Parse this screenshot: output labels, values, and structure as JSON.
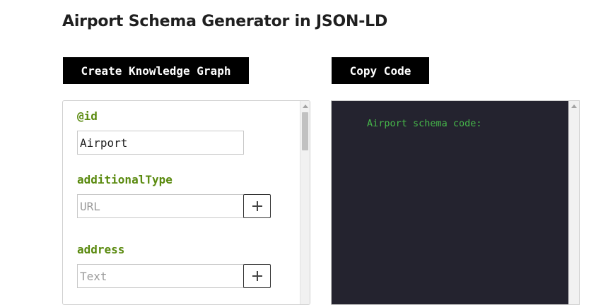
{
  "page": {
    "title": "Airport Schema Generator in JSON-LD"
  },
  "toolbar": {
    "create_label": "Create Knowledge Graph",
    "copy_label": "Copy Code"
  },
  "form": {
    "fields": [
      {
        "label": "@id",
        "value": "Airport",
        "placeholder": ""
      },
      {
        "label": "additionalType",
        "value": "",
        "placeholder": "URL"
      },
      {
        "label": "address",
        "value": "",
        "placeholder": "Text"
      }
    ]
  },
  "code": {
    "text": "Airport schema code:"
  },
  "icons": {
    "add": "plus-icon",
    "scroll_up": "chevron-up-icon"
  },
  "colors": {
    "label_green": "#5a8a0f",
    "code_background": "#24232f",
    "code_text": "#46b84a",
    "button_background": "#000000"
  }
}
